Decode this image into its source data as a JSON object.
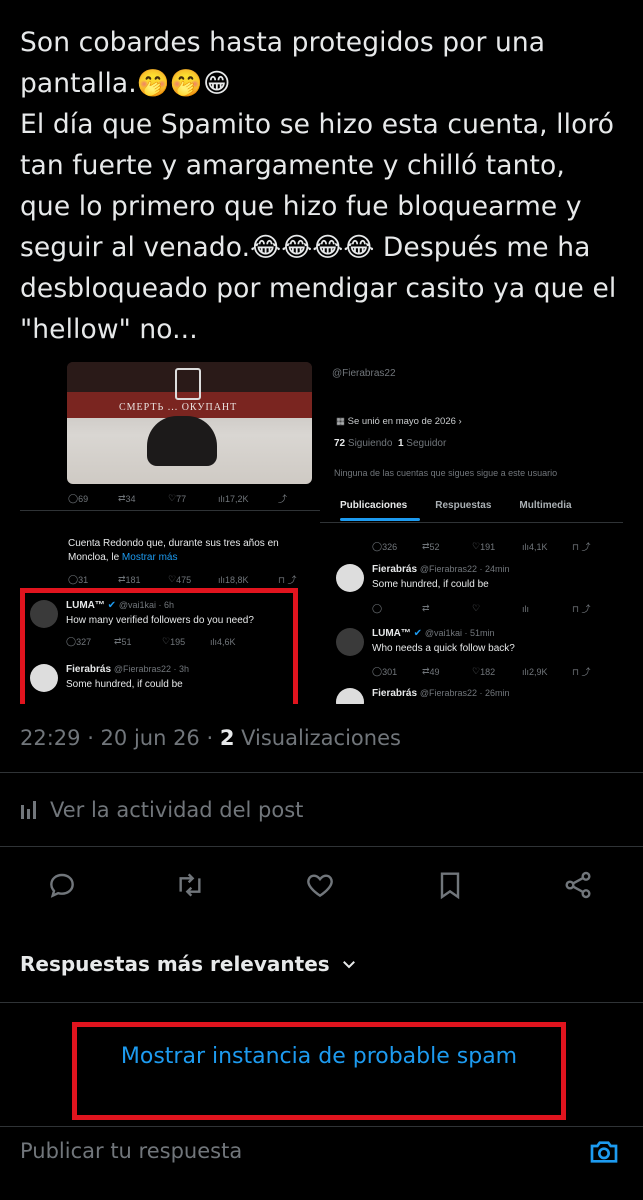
{
  "tweet": {
    "text": "Son cobardes hasta protegidos por una pantalla.🤭🤭😁\nEl día que Spamito se hizo esta cuenta, lloró tan fuerte y amargamente y chilló tanto, que lo primero que hizo fue bloquearme y seguir al venado.😂😂😂😂 Después me ha desbloqueado por mendigar casito ya que el \"hellow\" no...",
    "time": "22:29 · 20 jun 26 · ",
    "views_count": "2",
    "views_label": " Visualizaciones"
  },
  "embedded": {
    "left": {
      "banner_text": "СМЕРТЬ ... ОКУПАНТ",
      "stats1": {
        "replies": "69",
        "reposts": "34",
        "likes": "77",
        "views": "17,2K"
      },
      "post2_text": "Cuenta Redondo que, durante sus tres años en Moncloa, le ",
      "post2_more": "Mostrar más",
      "stats2": {
        "replies": "31",
        "reposts": "181",
        "likes": "475",
        "views": "18,8K"
      },
      "luma": {
        "name": "LUMA™",
        "handle": "@vai1kai · 6h",
        "text": "How many verified followers do you need?",
        "replies": "327",
        "reposts": "51",
        "likes": "195",
        "views": "4,6K"
      },
      "fier": {
        "name": "Fierabrás",
        "handle": "@Fierabras22 · 3h",
        "text": "Some hundred, if could be"
      }
    },
    "right": {
      "handle": "@Fierabras22",
      "joined": "Se unió en mayo de 2026",
      "following_count": "72",
      "following_label": "Siguiendo",
      "followers_count": "1",
      "followers_label": "Seguidor",
      "note": "Ninguna de las cuentas que sigues sigue a este usuario",
      "tabs": [
        "Publicaciones",
        "Respuestas",
        "Multimedia"
      ],
      "stats1": {
        "replies": "326",
        "reposts": "52",
        "likes": "191",
        "views": "4,1K"
      },
      "fier1": {
        "name": "Fierabrás",
        "handle": "@Fierabras22 · 24min",
        "text": "Some hundred, if could be"
      },
      "luma": {
        "name": "LUMA™",
        "handle": "@vai1kai · 51min",
        "text": "Who needs a quick follow back?",
        "replies": "301",
        "reposts": "49",
        "likes": "182",
        "views": "2,9K"
      },
      "fier2": {
        "name": "Fierabrás",
        "handle": "@Fierabras22 · 26min"
      }
    }
  },
  "activity_label": "Ver la actividad del post",
  "replies_sort_label": "Respuestas más relevantes",
  "spam_label": "Mostrar instancia de probable spam",
  "reply_placeholder": "Publicar tu respuesta",
  "colors": {
    "accent": "#1d9bf0",
    "red_box": "#e0141e",
    "text": "#e7e9ea",
    "muted": "#71767b"
  },
  "icons": [
    "reply-icon",
    "repost-icon",
    "like-icon",
    "bookmark-icon",
    "share-icon",
    "chart-icon",
    "chevron-down-icon",
    "camera-icon",
    "verified-icon"
  ]
}
